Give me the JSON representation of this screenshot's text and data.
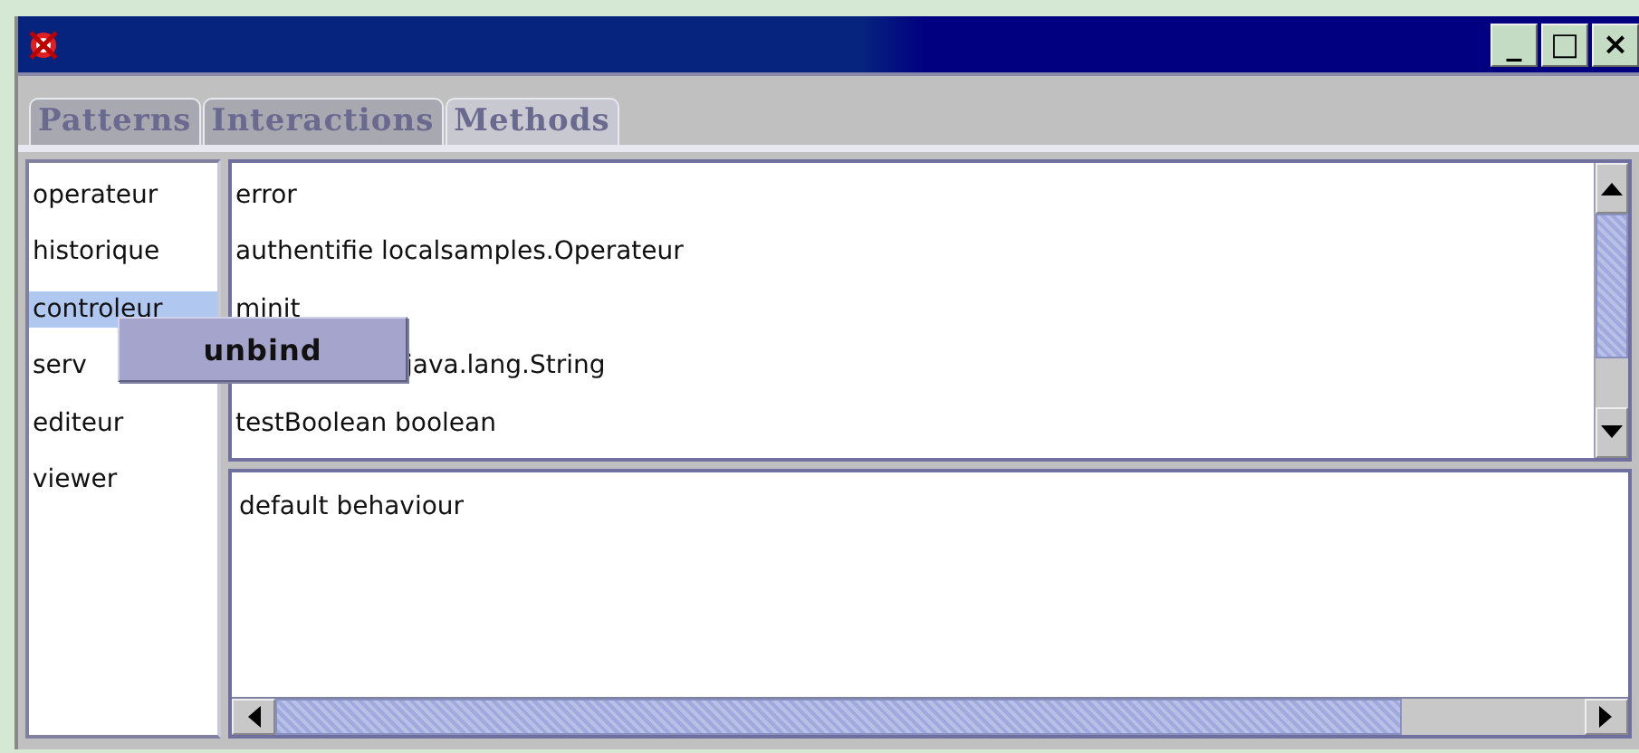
{
  "window": {
    "controls": [
      "_",
      "□",
      "×"
    ]
  },
  "tabs": [
    {
      "label": "Patterns",
      "selected": false
    },
    {
      "label": "Interactions",
      "selected": false
    },
    {
      "label": "Methods",
      "selected": true
    }
  ],
  "objects": [
    {
      "label": "operateur",
      "selected": false
    },
    {
      "label": "historique",
      "selected": false
    },
    {
      "label": "controleur",
      "selected": true
    },
    {
      "label": "serv",
      "selected": false
    },
    {
      "label": "editeur",
      "selected": false
    },
    {
      "label": "viewer",
      "selected": false
    }
  ],
  "context_menu": {
    "items": [
      "unbind"
    ]
  },
  "methods": [
    {
      "label": "error",
      "kind": "full"
    },
    {
      "label": "authentifie localsamples.Operateur",
      "kind": "full"
    },
    {
      "label": "minit",
      "kind": "full"
    },
    {
      "label": "java.lang.String",
      "kind": "partial"
    },
    {
      "label": "testBoolean boolean",
      "kind": "full"
    }
  ],
  "description": {
    "value": "default behaviour"
  }
}
